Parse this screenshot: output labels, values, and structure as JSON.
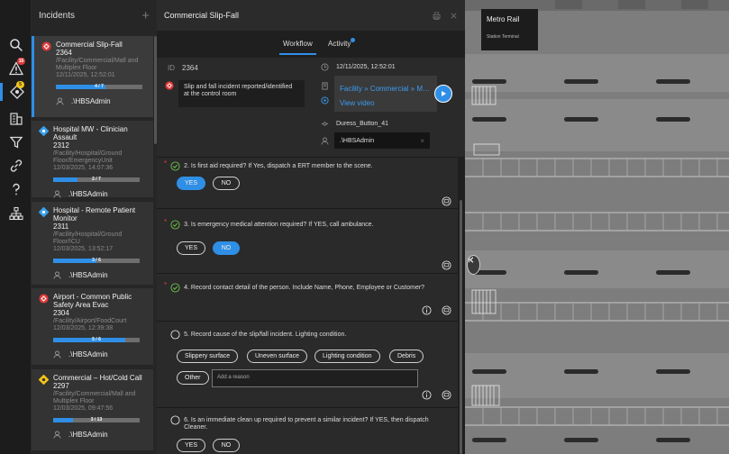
{
  "list": {
    "title": "Incidents",
    "add_label": "+",
    "cards": [
      {
        "title": "Commercial Slip-Fall",
        "id": "2364",
        "path": "/Facility/Commercial/Mall and Multiplex Floor",
        "time": "12/11/2025, 12:52:01",
        "progress_label": "4 / 7",
        "progress": 0.571,
        "assignee": ".\\HBSAdmin",
        "severity": "red",
        "title2": ""
      },
      {
        "title": "Hospital MW - Clinician Assault",
        "id": "2312",
        "path": "/Facility/Hospital/Ground Floor/EmergencyUnit",
        "time": "12/03/2025, 14:07:36",
        "progress_label": "2 / 7",
        "progress": 0.286,
        "assignee": ".\\HBSAdmin",
        "severity": "blue",
        "title2": ""
      },
      {
        "title": "Hospital - Remote Patient Monitor",
        "id": "2311",
        "path": "/Facility/Hospital/Ground Floor/ICU",
        "time": "12/03/2025, 13:52:17",
        "progress_label": "3 / 6",
        "progress": 0.5,
        "assignee": ".\\HBSAdmin",
        "severity": "blue",
        "title2": ""
      },
      {
        "title": "Airport - Common Public Safety Area Evac",
        "id": "2304",
        "path": "/Facility/Airport/FoodCourt",
        "time": "12/03/2025, 12:39:38",
        "progress_label": "5 / 6",
        "progress": 0.833,
        "assignee": ".\\HBSAdmin",
        "severity": "red",
        "title2": ""
      },
      {
        "title": "Commercial – Hot/Cold Call",
        "id": "2297",
        "path": "/Facility/Commercial/Mall and Multiplex Floor",
        "time": "12/03/2025, 09:47:56",
        "progress_label": "3 / 13",
        "progress": 0.231,
        "assignee": ".\\HBSAdmin",
        "severity": "yellow",
        "title2": ""
      }
    ]
  },
  "rail": {
    "alerts_count": "16",
    "incidents_count": "5"
  },
  "detail": {
    "title": "Commercial Slip-Fall",
    "tabs": [
      {
        "label": "Workflow"
      },
      {
        "label": "Activity"
      }
    ],
    "id_label": "ID",
    "id_value": "2364",
    "datetime": "12/11/2025, 12:52:01",
    "description": "Slip and fall incident reported/identified at the control room",
    "location_link": "Facility » Commercial » Mall and Multiplex Floor",
    "video_link": "View video",
    "source": "Duress_Button_41",
    "assignee": ".\\HBSAdmin",
    "assignee_clear": "×"
  },
  "questions": [
    {
      "num": "2.",
      "text": "Is first aid required? If Yes, dispatch a ERT member to the scene.",
      "done": true,
      "options": [
        "YES",
        "NO"
      ],
      "selected": "YES"
    },
    {
      "num": "3.",
      "text": "Is emergency medical attention required? If YES, call ambulance.",
      "done": true,
      "options": [
        "YES",
        "NO"
      ],
      "selected": "NO"
    },
    {
      "num": "4.",
      "text": "Record contact detail of the person. Include Name, Phone, Employee or Customer?",
      "done": true
    },
    {
      "num": "5.",
      "text": "Record cause of the slip/fall incident. Lighting condition.",
      "done": false,
      "options": [
        "Slippery surface",
        "Uneven surface",
        "Lighting condition",
        "Debris",
        "Other"
      ],
      "reason_placeholder": "Add a reason"
    },
    {
      "num": "6.",
      "text": "Is an immediate clean up required to prevent a similar incident? If YES, then dispatch Cleaner.",
      "done": false,
      "options": [
        "YES",
        "NO"
      ]
    }
  ],
  "map": {
    "title": "Metro Rail",
    "subtitle": "Station Terminal"
  },
  "colors": {
    "accent": "#2f8fe6",
    "danger": "#e03a3a",
    "warning": "#f2c318",
    "success": "#6cc04a"
  }
}
